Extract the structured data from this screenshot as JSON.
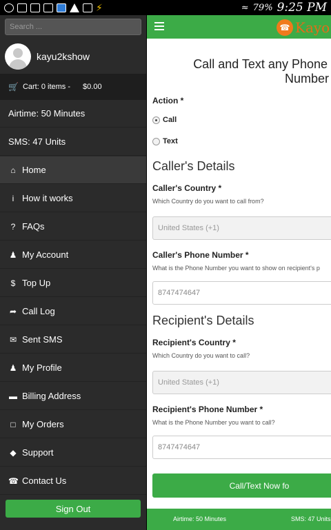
{
  "status_bar": {
    "notification_icons": [
      "whatsapp-icon",
      "image-icon",
      "picture-icon",
      "mail-icon",
      "messenger-icon",
      "warning-icon",
      "google-plus-icon",
      "charging-icon"
    ],
    "battery": "79%",
    "time": "9:25 PM"
  },
  "sidebar": {
    "search_placeholder": "Search ...",
    "username": "kayu2kshow",
    "cart": {
      "label": "Cart: 0 items -",
      "total": "$0.00"
    },
    "airtime": "Airtime: 50 Minutes",
    "sms": "SMS: 47 Units",
    "items": [
      {
        "label": "Home",
        "icon": "home-icon"
      },
      {
        "label": "How it works",
        "icon": "info-icon"
      },
      {
        "label": "FAQs",
        "icon": "question-icon"
      },
      {
        "label": "My Account",
        "icon": "user-icon"
      },
      {
        "label": "Top Up",
        "icon": "dollar-icon"
      },
      {
        "label": "Call Log",
        "icon": "share-icon"
      },
      {
        "label": "Sent SMS",
        "icon": "envelope-icon"
      },
      {
        "label": "My Profile",
        "icon": "person-icon"
      },
      {
        "label": "Billing Address",
        "icon": "credit-card-icon"
      },
      {
        "label": "My Orders",
        "icon": "folder-open-icon"
      },
      {
        "label": "Support",
        "icon": "ticket-icon"
      },
      {
        "label": "Contact Us",
        "icon": "phone-icon"
      }
    ],
    "sign_out": "Sign Out"
  },
  "main": {
    "logo_text": "Kayo",
    "heading_line1": "Call and Text any Phone Nu",
    "heading_line2": "Number for",
    "action_label": "Action *",
    "action_options": [
      {
        "label": "Call",
        "selected": true
      },
      {
        "label": "Text",
        "selected": false
      }
    ],
    "caller_section": "Caller's Details",
    "caller_country_label": "Caller's Country *",
    "caller_country_help": "Which Country do you want to call from?",
    "caller_country_value": "United States (+1)",
    "caller_phone_label": "Caller's Phone Number *",
    "caller_phone_help": "What is the Phone Number you want to show on recipient's p",
    "caller_phone_value": "8747474647",
    "recipient_section": "Recipient's Details",
    "recipient_country_label": "Recipient's Country *",
    "recipient_country_help": "Which Country do you want to call?",
    "recipient_country_value": "United States (+1)",
    "recipient_phone_label": "Recipient's Phone Number *",
    "recipient_phone_help": "What is the Phone Number you want to call?",
    "recipient_phone_value": "8747474647",
    "submit_label": "Call/Text Now fo",
    "footer_airtime": "Airtime: 50 Minutes",
    "footer_sms": "SMS: 47 Units"
  },
  "colors": {
    "brand_green": "#3cab47",
    "logo_orange": "#e36d18",
    "sidebar_bg": "#2b2b2b"
  }
}
